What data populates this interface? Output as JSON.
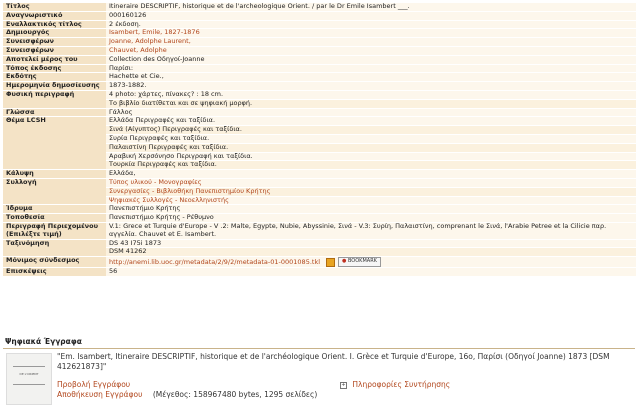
{
  "metadata": [
    {
      "label": "Τίτλος",
      "values": [
        {
          "text": "Itineraire DESCRIPTIF, historique et de l'archeologique Orient. / par le Dr Emile Isambert ___.",
          "link": false
        }
      ]
    },
    {
      "label": "Αναγνωριστικό",
      "values": [
        {
          "text": "000160126",
          "link": false
        }
      ]
    },
    {
      "label": "Εναλλακτικός τίτλος",
      "values": [
        {
          "text": "2 έκδοση.",
          "link": false
        }
      ]
    },
    {
      "label": "Δημιουργός",
      "values": [
        {
          "text": "Isambert, Emile,     1827-1876",
          "link": true
        }
      ]
    },
    {
      "label": "Συνεισφέρων",
      "values": [
        {
          "text": "Joanne, Adolphe Laurent,",
          "link": true
        }
      ]
    },
    {
      "label": "Συνεισφέρων",
      "values": [
        {
          "text": "Chauvet, Adolphe",
          "link": true
        }
      ]
    },
    {
      "label": "Αποτελεί μέρος του",
      "values": [
        {
          "text": "Collection des Οδηγοί-Joanne",
          "link": false
        }
      ]
    },
    {
      "label": "Τόπος έκδοσης",
      "values": [
        {
          "text": "Παρίσι:",
          "link": false
        }
      ]
    },
    {
      "label": "Εκδότης",
      "values": [
        {
          "text": "Hachette et Cie.,",
          "link": false
        }
      ]
    },
    {
      "label": "Ημερομηνία δημοσίευσης",
      "values": [
        {
          "text": "1873-1882.",
          "link": false
        }
      ]
    },
    {
      "label": "Φυσική περιγραφή",
      "values": [
        {
          "text": "4 photo: χάρτες, πίνακες? : 18 cm.",
          "link": false
        },
        {
          "text": "Το βιβλίο διατίθεται και σε ψηφιακή μορφή.",
          "link": false
        }
      ]
    },
    {
      "label": "Γλώσσα",
      "values": [
        {
          "text": "Γάλλος",
          "link": false
        }
      ]
    },
    {
      "label": "Θέμα LCSH",
      "values": [
        {
          "text": "Ελλάδα Περιγραφές και ταξίδια.",
          "link": false
        },
        {
          "text": "Σινά (Αίγυπτος) Περιγραφές και ταξίδια.",
          "link": false
        },
        {
          "text": "Συρία Περιγραφές και ταξίδια.",
          "link": false
        },
        {
          "text": "Παλαιστίνη Περιγραφές και ταξίδια.",
          "link": false
        },
        {
          "text": "Αραβική Χερσόνησο Περιγραφή και ταξίδια.",
          "link": false
        },
        {
          "text": "Τουρκία Περιγραφές και ταξίδια.",
          "link": false
        }
      ]
    },
    {
      "label": "Κάλυψη",
      "values": [
        {
          "text": "Ελλάδα,",
          "link": false
        }
      ]
    },
    {
      "label": "Συλλογή",
      "values": [
        {
          "text": "Τύπος υλικού - Μονογραφίες",
          "link": true
        },
        {
          "text": "Συνεργασίες - Βιβλιοθήκη Πανεπιστημίου Κρήτης",
          "link": true
        },
        {
          "text": "Ψηφιακές Συλλογές - Νεοελληνιστής",
          "link": true
        }
      ]
    },
    {
      "label": "Ίδρυμα",
      "values": [
        {
          "text": "Πανεπιστήμιο Κρήτης",
          "link": false
        }
      ]
    },
    {
      "label": "Τοποθεσία",
      "values": [
        {
          "text": "Πανεπιστήμιο Κρήτης - Ρέθυμνο",
          "link": false
        }
      ]
    },
    {
      "label": "Περιγραφή Περιεχομένου (Επιλέξτε τιμή)",
      "values": [
        {
          "text": "V.1: Grece et Turquie d'Europe - V .2: Malte, Egypte, Nubie, Abyssinie, Σινά - V.3: Συρίη, Παλαιστίνη, comprenant le Σινά, l'Arabie Petree et la Cilicie παρ. αγγελία. Chauvet et E. Isambert.",
          "link": false
        }
      ]
    },
    {
      "label": "Ταξινόμηση",
      "values": [
        {
          "text": "DS 43 I75i 1873",
          "link": false
        },
        {
          "text": "DSM 41262",
          "link": false
        }
      ]
    },
    {
      "label": "Μόνιμος σύνδεσμος",
      "values": [
        {
          "text": "http://anemi.lib.uoc.gr/metadata/2/9/2/metadata-01-0001085.tkl",
          "link": true,
          "bookmark": true
        }
      ]
    },
    {
      "label": "Επισκέψεις",
      "values": [
        {
          "text": "56",
          "link": false
        }
      ]
    }
  ],
  "bookmark": {
    "label": "BOOKMARK"
  },
  "digital": {
    "section_title": "Ψηφιακά Έγγραφα",
    "thumb_caption": "DE L'ORIENT",
    "doc_title": "\"Em. Isambert, Itineraire DESCRIPTIF, historique et de l'archéologique Orient. I. Grèce et Turquie d'Europe, 16ο, Παρίσι (Οδηγοί Joanne) 1873 [DSM 412621873]\"",
    "view_link": "Προβολή Εγγράφου",
    "save_link": "Αποθήκευση Εγγράφου",
    "size_text": "(Μέγεθος: 158967480 bytes, 1295 σελίδες)",
    "system_info": "Πληροφορίες Συντήρησης"
  }
}
